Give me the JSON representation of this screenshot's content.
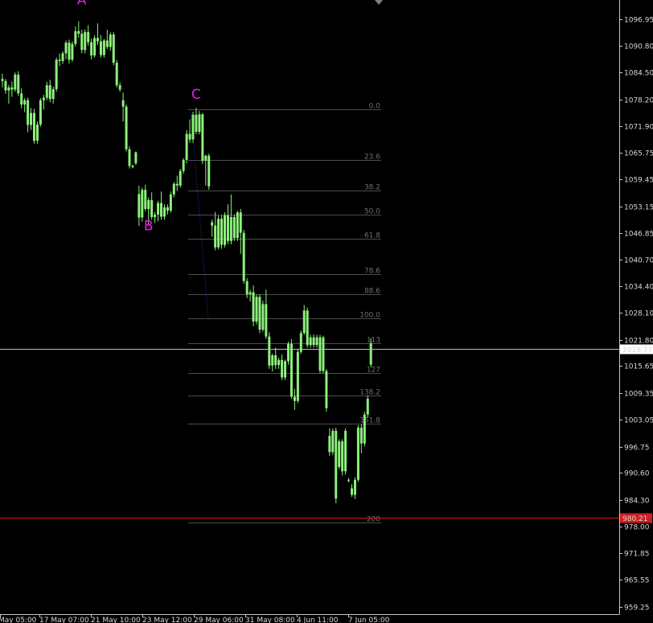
{
  "chart_data": {
    "type": "candlestick",
    "colors": {
      "background": "#000000",
      "candle": "#8cf07a",
      "wave_label": "#e61ee6",
      "current_price_line": "#b4bec8",
      "support_line": "#d21e1e"
    },
    "y_axis": {
      "ticks": [
        "1096.95",
        "1090.80",
        "1084.50",
        "1078.20",
        "1071.90",
        "1065.75",
        "1059.45",
        "1053.15",
        "1046.85",
        "1040.70",
        "1034.40",
        "1028.10",
        "1021.80",
        "1015.65",
        "1009.35",
        "1003.05",
        "996.75",
        "990.60",
        "984.30",
        "978.00",
        "971.85",
        "965.55",
        "959.25"
      ],
      "ylim": [
        957.5,
        1101.5
      ]
    },
    "x_axis": {
      "ticks": [
        "May 05:00",
        "17 May 07:00",
        "21 May 10:00",
        "23 May 12:00",
        "29 May 06:00",
        "31 May 08:00",
        "4 Jun 11:00",
        "7 Jun 05:00"
      ]
    },
    "current_price": {
      "label": "1019.77",
      "value": 1019.77
    },
    "support_price": {
      "label": "980.21",
      "value": 980.21
    },
    "wave_labels": [
      {
        "text": "A",
        "bar": 25,
        "price": 1100.5
      },
      {
        "text": "B",
        "bar": 46,
        "price": 1047.5
      },
      {
        "text": "C",
        "bar": 61,
        "price": 1078.3
      }
    ],
    "fibonacci": {
      "levels": [
        {
          "label": "0.0",
          "price": 1075.8
        },
        {
          "label": "23.6",
          "price": 1064.0
        },
        {
          "label": "38.2",
          "price": 1056.9
        },
        {
          "label": "50.0",
          "price": 1051.1
        },
        {
          "label": "61.8",
          "price": 1045.5
        },
        {
          "label": "78.6",
          "price": 1037.3
        },
        {
          "label": "88.6",
          "price": 1032.5
        },
        {
          "label": "100.0",
          "price": 1026.9
        },
        {
          "label": "113",
          "price": 1021.0
        },
        {
          "label": "127",
          "price": 1014.1
        },
        {
          "label": "138.2",
          "price": 1008.7
        },
        {
          "label": "151.8",
          "price": 1002.1
        },
        {
          "label": "200",
          "price": 978.9
        }
      ]
    },
    "candles": [
      [
        1083.0,
        1084.2,
        1081.0,
        1082.5
      ],
      [
        1082.5,
        1083.0,
        1079.5,
        1080.3
      ],
      [
        1080.3,
        1081.6,
        1077.2,
        1081.0
      ],
      [
        1081.0,
        1082.4,
        1078.8,
        1080.5
      ],
      [
        1080.5,
        1084.5,
        1080.0,
        1084.0
      ],
      [
        1084.0,
        1084.8,
        1079.0,
        1079.6
      ],
      [
        1079.6,
        1080.8,
        1076.1,
        1077.0
      ],
      [
        1077.0,
        1078.5,
        1075.2,
        1078.0
      ],
      [
        1078.0,
        1078.6,
        1070.5,
        1072.2
      ],
      [
        1072.2,
        1076.2,
        1071.0,
        1075.0
      ],
      [
        1075.0,
        1076.0,
        1067.8,
        1068.5
      ],
      [
        1068.5,
        1073.0,
        1067.8,
        1072.3
      ],
      [
        1072.3,
        1078.5,
        1071.8,
        1078.0
      ],
      [
        1078.0,
        1079.3,
        1075.8,
        1078.6
      ],
      [
        1078.6,
        1082.3,
        1078.0,
        1081.5
      ],
      [
        1081.5,
        1082.8,
        1077.5,
        1078.3
      ],
      [
        1078.3,
        1081.2,
        1077.2,
        1080.6
      ],
      [
        1080.6,
        1088.0,
        1080.0,
        1087.5
      ],
      [
        1087.5,
        1089.0,
        1086.0,
        1087.2
      ],
      [
        1087.2,
        1089.5,
        1086.5,
        1089.0
      ],
      [
        1089.0,
        1092.0,
        1087.6,
        1091.5
      ],
      [
        1091.5,
        1092.2,
        1086.6,
        1087.5
      ],
      [
        1087.5,
        1091.8,
        1087.0,
        1091.2
      ],
      [
        1091.2,
        1095.3,
        1090.6,
        1094.2
      ],
      [
        1094.2,
        1096.5,
        1092.6,
        1093.6
      ],
      [
        1093.6,
        1094.5,
        1089.0,
        1089.8
      ],
      [
        1089.8,
        1094.6,
        1089.0,
        1094.0
      ],
      [
        1094.0,
        1095.6,
        1090.8,
        1091.6
      ],
      [
        1091.6,
        1092.4,
        1087.6,
        1088.5
      ],
      [
        1088.5,
        1093.2,
        1088.0,
        1092.6
      ],
      [
        1092.6,
        1096.0,
        1091.0,
        1091.8
      ],
      [
        1091.8,
        1093.3,
        1088.0,
        1088.6
      ],
      [
        1088.6,
        1092.4,
        1088.0,
        1092.0
      ],
      [
        1092.0,
        1094.5,
        1090.0,
        1090.5
      ],
      [
        1090.5,
        1093.9,
        1089.6,
        1093.4
      ],
      [
        1093.4,
        1094.0,
        1086.2,
        1086.8
      ],
      [
        1086.8,
        1087.4,
        1081.0,
        1081.5
      ],
      [
        1081.5,
        1082.2,
        1080.0,
        1080.5
      ],
      [
        1078.0,
        1079.8,
        1073.0,
        1076.5
      ],
      [
        1076.5,
        1077.0,
        1066.0,
        1066.5
      ],
      [
        1066.5,
        1067.2,
        1062.0,
        1062.6
      ],
      [
        1062.6,
        1063.0,
        1062.0,
        1062.3
      ],
      [
        1065.8,
        1066.0,
        1062.8,
        1063.2
      ],
      [
        1056.0,
        1058.0,
        1048.5,
        1050.5
      ],
      [
        1050.5,
        1057.5,
        1049.5,
        1057.0
      ],
      [
        1057.0,
        1058.2,
        1052.0,
        1052.5
      ],
      [
        1052.5,
        1055.2,
        1048.7,
        1054.6
      ],
      [
        1054.6,
        1056.4,
        1050.0,
        1050.6
      ],
      [
        1050.6,
        1051.8,
        1049.2,
        1051.2
      ],
      [
        1051.2,
        1054.4,
        1049.6,
        1053.9
      ],
      [
        1053.9,
        1056.6,
        1050.0,
        1050.7
      ],
      [
        1050.7,
        1053.6,
        1050.0,
        1052.9
      ],
      [
        1052.9,
        1053.6,
        1051.2,
        1052.1
      ],
      [
        1052.1,
        1056.6,
        1051.6,
        1055.9
      ],
      [
        1055.9,
        1058.8,
        1055.2,
        1058.4
      ],
      [
        1058.4,
        1060.3,
        1056.7,
        1058.0
      ],
      [
        1058.0,
        1061.9,
        1057.5,
        1061.4
      ],
      [
        1061.4,
        1064.4,
        1060.8,
        1064.0
      ],
      [
        1064.0,
        1071.0,
        1063.2,
        1070.1
      ],
      [
        1070.1,
        1073.5,
        1068.0,
        1068.8
      ],
      [
        1068.8,
        1075.3,
        1068.0,
        1074.6
      ],
      [
        1074.6,
        1076.2,
        1070.0,
        1070.6
      ],
      [
        1070.6,
        1075.5,
        1070.0,
        1074.7
      ],
      [
        1074.7,
        1075.0,
        1063.0,
        1063.8
      ],
      [
        1063.8,
        1065.2,
        1058.0,
        1065.0
      ],
      [
        1065.0,
        1065.5,
        1057.0,
        1057.8
      ],
      [
        1049.4,
        1050.0,
        1046.0,
        1048.6
      ],
      [
        1048.6,
        1051.8,
        1042.8,
        1043.5
      ],
      [
        1043.5,
        1051.0,
        1043.0,
        1050.2
      ],
      [
        1050.2,
        1051.0,
        1043.2,
        1044.1
      ],
      [
        1044.1,
        1051.7,
        1043.5,
        1051.0
      ],
      [
        1051.0,
        1053.6,
        1044.3,
        1045.0
      ],
      [
        1045.0,
        1055.9,
        1044.2,
        1050.6
      ],
      [
        1050.6,
        1051.2,
        1045.0,
        1045.7
      ],
      [
        1045.7,
        1052.1,
        1045.0,
        1051.7
      ],
      [
        1051.7,
        1052.5,
        1042.0,
        1046.9
      ],
      [
        1046.9,
        1047.6,
        1035.0,
        1035.6
      ],
      [
        1035.6,
        1036.3,
        1031.6,
        1032.5
      ],
      [
        1032.5,
        1033.6,
        1030.8,
        1033.0
      ],
      [
        1033.0,
        1034.6,
        1025.0,
        1026.1
      ],
      [
        1026.1,
        1032.4,
        1025.4,
        1031.9
      ],
      [
        1031.9,
        1032.5,
        1023.4,
        1024.2
      ],
      [
        1024.2,
        1031.0,
        1023.7,
        1030.2
      ],
      [
        1030.2,
        1033.6,
        1022.0,
        1022.6
      ],
      [
        1022.6,
        1023.6,
        1015.0,
        1015.8
      ],
      [
        1015.8,
        1018.6,
        1014.4,
        1018.2
      ],
      [
        1018.2,
        1020.0,
        1015.0,
        1015.9
      ],
      [
        1015.9,
        1017.6,
        1015.0,
        1017.1
      ],
      [
        1017.1,
        1018.4,
        1012.4,
        1013.0
      ],
      [
        1013.0,
        1017.2,
        1012.4,
        1016.8
      ],
      [
        1016.8,
        1021.4,
        1016.0,
        1020.9
      ],
      [
        1020.9,
        1022.0,
        1008.0,
        1008.5
      ],
      [
        1008.5,
        1010.3,
        1005.4,
        1007.5
      ],
      [
        1007.5,
        1019.6,
        1007.0,
        1019.0
      ],
      [
        1019.0,
        1024.0,
        1018.5,
        1023.4
      ],
      [
        1023.4,
        1030.0,
        1023.0,
        1028.7
      ],
      [
        1028.7,
        1029.4,
        1020.0,
        1020.6
      ],
      [
        1020.6,
        1023.0,
        1020.0,
        1022.4
      ],
      [
        1022.4,
        1023.1,
        1020.0,
        1020.6
      ],
      [
        1020.6,
        1023.0,
        1020.0,
        1022.4
      ],
      [
        1022.4,
        1023.0,
        1014.0,
        1014.6
      ],
      [
        1022.4,
        1022.8,
        1014.0,
        1014.5
      ],
      [
        1014.5,
        1015.0,
        1005.0,
        1005.8
      ],
      [
        999.3,
        1001.1,
        994.6,
        995.5
      ],
      [
        995.5,
        1001.0,
        994.8,
        1000.5
      ],
      [
        1000.5,
        1001.2,
        983.5,
        984.6
      ],
      [
        992.0,
        998.5,
        991.5,
        998.0
      ],
      [
        998.0,
        998.5,
        990.0,
        991.0
      ],
      [
        991.0,
        1001.1,
        990.2,
        1000.5
      ],
      [
        989.0,
        989.4,
        988.4,
        988.8
      ],
      [
        987.0,
        988.0,
        985.0,
        985.5
      ],
      [
        985.5,
        989.6,
        984.5,
        989.0
      ],
      [
        989.0,
        1001.8,
        988.5,
        1001.2
      ],
      [
        1001.2,
        1002.0,
        995.2,
        997.5
      ],
      [
        997.5,
        1005.0,
        996.8,
        1004.3
      ],
      [
        1004.3,
        1008.8,
        1003.5,
        1008.0
      ],
      [
        1016.0,
        1022.2,
        1015.4,
        1021.0
      ]
    ]
  }
}
